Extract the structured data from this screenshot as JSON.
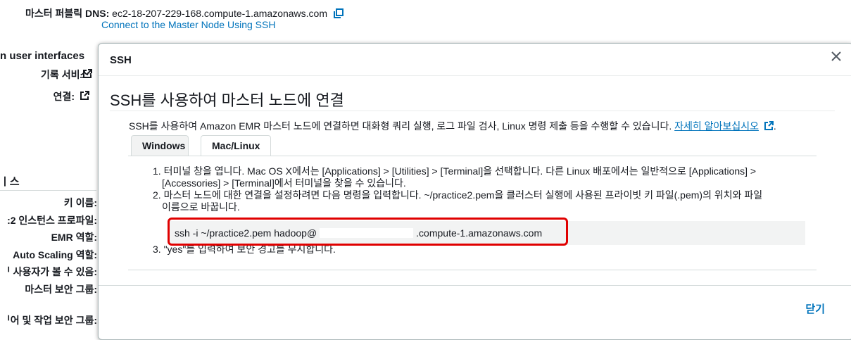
{
  "background": {
    "dns_label": "마스터 퍼블릭 DNS:",
    "dns_value": "ec2-18-207-229-168.compute-1.amazonaws.com",
    "ssh_link": "Connect to the Master Node Using SSH",
    "section_ui": "n user interfaces",
    "history_label": "기록 서비스:",
    "connect_label": "연결:",
    "section_security": "ㅣ스",
    "labels": [
      "키 이름:",
      ":2 인스턴스 프로파일:",
      "EMR 역할:",
      "Auto Scaling 역할:",
      "ᅵ 사용자가 볼 수 있음:",
      "마스터 보안 그룹:",
      "ᅵ어 및 작업 보안 그룹:"
    ]
  },
  "modal": {
    "title": "SSH",
    "heading": "SSH를 사용하여 마스터 노드에 연결",
    "description": "SSH를 사용하여 Amazon EMR 마스터 노드에 연결하면 대화형 쿼리 실행, 로그 파일 검사, Linux 명령 제출 등을 수행할 수 있습니다.",
    "learn_more": "자세히 알아보십시오",
    "tabs": [
      "Windows",
      "Mac/Linux"
    ],
    "active_tab": "Mac/Linux",
    "step1_line1": "1. 터미널 창을 엽니다. Mac OS X에서는 [Applications] > [Utilities] > [Terminal]을 선택합니다. 다른 Linux 배포에서는 일반적으로 [Applications] >",
    "step1_line2": "[Accessories] > [Terminal]에서 터미널을 찾을 수 있습니다.",
    "step2_line1": "2. 마스터 노드에 대한 연결을 설정하려면 다음 명령을 입력합니다. ~/practice2.pem을 클러스터 실행에 사용된 프라이빗 키 파일(.pem)의 위치와 파일",
    "step2_line2": "이름으로 바꿉니다.",
    "command_prefix": "ssh -i ~/practice2.pem hadoop@",
    "command_suffix": ".compute-1.amazonaws.com",
    "step3": "3. \"yes\"를 입력하여 보안 경고를 무시합니다.",
    "close_label": "닫기"
  },
  "colors": {
    "link": "#0073bb",
    "highlight": "#e00000",
    "command_bg": "#f2f3f3"
  },
  "icons": [
    "copy-icon",
    "external-link-icon",
    "close-icon"
  ]
}
